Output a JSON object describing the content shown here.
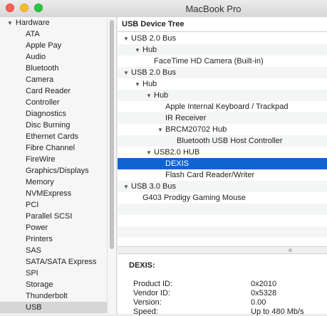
{
  "window": {
    "title": "MacBook Pro"
  },
  "sidebar": {
    "group_label": "Hardware",
    "items": [
      "ATA",
      "Apple Pay",
      "Audio",
      "Bluetooth",
      "Camera",
      "Card Reader",
      "Controller",
      "Diagnostics",
      "Disc Burning",
      "Ethernet Cards",
      "Fibre Channel",
      "FireWire",
      "Graphics/Displays",
      "Memory",
      "NVMExpress",
      "PCI",
      "Parallel SCSI",
      "Power",
      "Printers",
      "SAS",
      "SATA/SATA Express",
      "SPI",
      "Storage",
      "Thunderbolt",
      "USB"
    ],
    "selected": "USB"
  },
  "tree": {
    "header": "USB Device Tree",
    "rows": [
      {
        "label": "USB 2.0 Bus",
        "level": 0,
        "expanded": true
      },
      {
        "label": "Hub",
        "level": 1,
        "expanded": true
      },
      {
        "label": "FaceTime HD Camera (Built-in)",
        "level": 2
      },
      {
        "label": "USB 2.0 Bus",
        "level": 0,
        "expanded": true
      },
      {
        "label": "Hub",
        "level": 1,
        "expanded": true
      },
      {
        "label": "Hub",
        "level": 2,
        "expanded": true
      },
      {
        "label": "Apple Internal Keyboard / Trackpad",
        "level": 3
      },
      {
        "label": "IR Receiver",
        "level": 3
      },
      {
        "label": "BRCM20702 Hub",
        "level": 3,
        "expanded": true
      },
      {
        "label": "Bluetooth USB Host Controller",
        "level": 4
      },
      {
        "label": "USB2.0 HUB",
        "level": 2,
        "expanded": true
      },
      {
        "label": "DEXIS",
        "level": 3,
        "selected": true
      },
      {
        "label": "Flash Card Reader/Writer",
        "level": 3
      },
      {
        "label": "USB 3.0 Bus",
        "level": 0,
        "expanded": true
      },
      {
        "label": "G403 Prodigy Gaming Mouse",
        "level": 1
      }
    ]
  },
  "detail": {
    "title": "DEXIS:",
    "properties": [
      {
        "name": "Product ID:",
        "value": "0x2010"
      },
      {
        "name": "Vendor ID:",
        "value": "0x5328"
      },
      {
        "name": "Version:",
        "value": "0.00"
      },
      {
        "name": "Speed:",
        "value": "Up to 480 Mb/s"
      }
    ]
  },
  "colors": {
    "selection": "#0f64d2",
    "sidebar_selection": "#d6d6d6"
  },
  "icons": {
    "expand": "disclosure-triangle-icon"
  }
}
